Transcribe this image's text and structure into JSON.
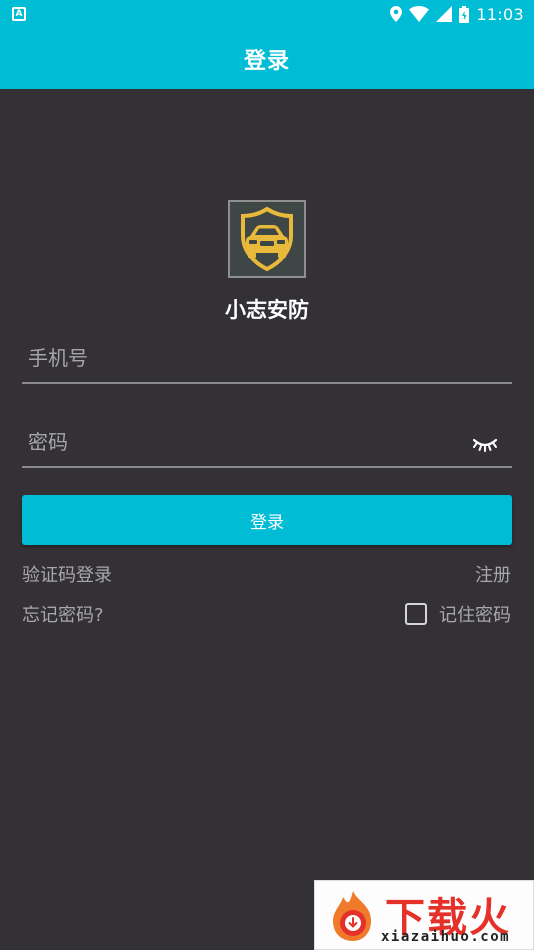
{
  "status_bar": {
    "app_badge": "A",
    "time": "11:03",
    "icons": [
      "location-icon",
      "wifi-icon",
      "signal-icon",
      "battery-icon"
    ]
  },
  "app_bar": {
    "title": "登录"
  },
  "logo": {
    "icon": "car-shield-logo"
  },
  "app_name": "小志安防",
  "form": {
    "phone_placeholder": "手机号",
    "phone_value": "",
    "password_placeholder": "密码",
    "password_value": "",
    "toggle_icon": "eye-closed-icon"
  },
  "login_button": "登录",
  "links": {
    "code_login": "验证码登录",
    "register": "注册",
    "forgot": "忘记密码?",
    "remember": "记住密码",
    "remember_checked": false
  },
  "watermark": {
    "text": "下载火",
    "url": "xiazaihuo.com"
  },
  "colors": {
    "accent": "#00BCD4",
    "background": "#333135",
    "link": "#a8a7ab",
    "underline": "#8a898d",
    "logo_gold": "#e8b93a"
  }
}
